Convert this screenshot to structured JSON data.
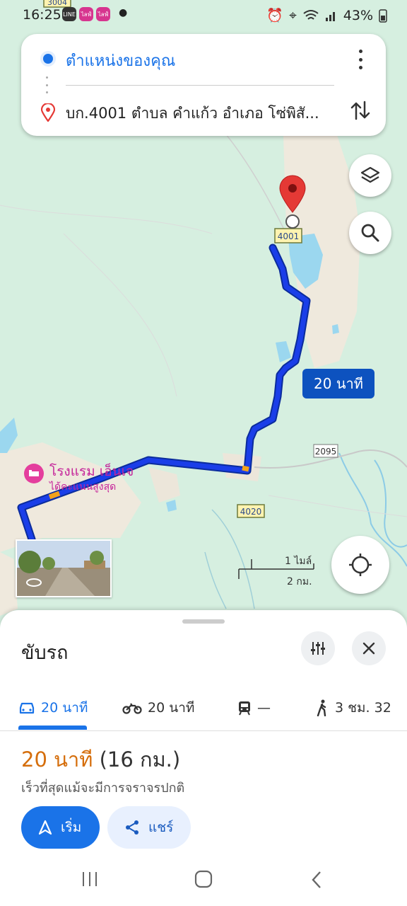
{
  "status_bar": {
    "time": "16:25",
    "battery": "43%",
    "notification_apps": [
      "LINE",
      "ไลฟ์",
      "ไลฟ์"
    ]
  },
  "directions": {
    "origin": "ตำแหน่งของคุณ",
    "destination": "บก.4001 ตำบล คำแก้ว อำเภอ โซ่พิสั..."
  },
  "map": {
    "route_eta_label": "20 นาที",
    "road_labels": [
      "4001",
      "2095",
      "4020",
      "3004"
    ],
    "poi": {
      "name": "โรงแรม เอ็นเจ",
      "subtitle": "ได้คะแนนสูงสุด"
    },
    "scale": {
      "imperial": "1 ไมล์",
      "metric": "2 กม."
    }
  },
  "sheet": {
    "title": "ขับรถ",
    "tabs": [
      {
        "mode": "car",
        "label": "20 นาที",
        "icon": "car-icon",
        "active": true
      },
      {
        "mode": "motorcycle",
        "label": "20 นาที",
        "icon": "motorcycle-icon",
        "active": false
      },
      {
        "mode": "transit",
        "label": "—",
        "icon": "train-icon",
        "active": false
      },
      {
        "mode": "walk",
        "label": "3 ชม. 32",
        "icon": "walk-icon",
        "active": false
      }
    ],
    "route_time": "20 นาที",
    "route_distance": "(16 กม.)",
    "route_note": "เร็วที่สุดแม้จะมีการจราจรปกติ",
    "start_label": "เริ่ม",
    "share_label": "แชร์"
  },
  "colors": {
    "accent": "#1a73e8",
    "route": "#1a3ee8",
    "eta_orange": "#d56e0c",
    "poi_pink": "#c5249a"
  }
}
